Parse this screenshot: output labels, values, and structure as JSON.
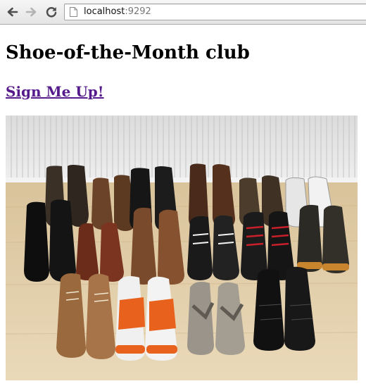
{
  "browser": {
    "url_host": "localhost",
    "url_rest": ":9292",
    "back_icon": "back-arrow-icon",
    "forward_icon": "forward-arrow-icon",
    "reload_icon": "reload-icon",
    "page_icon": "page-icon"
  },
  "page": {
    "title": "Shoe-of-the-Month club",
    "signup_link": "Sign Me Up!",
    "link_color": "#551a8b"
  }
}
